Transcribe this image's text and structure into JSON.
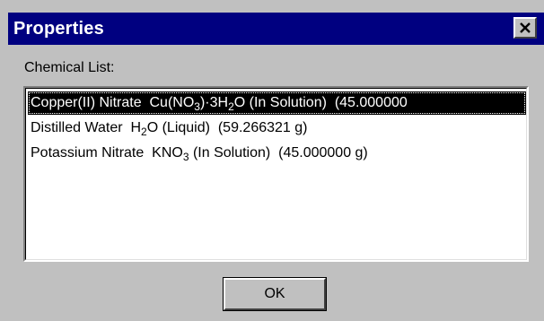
{
  "window": {
    "title": "Properties",
    "close_icon": "close-icon"
  },
  "chemical_list": {
    "label": "Chemical List:",
    "selected_index": 0,
    "items": [
      {
        "name": "Copper(II) Nitrate",
        "formula_parts": [
          "Cu(NO",
          "3",
          ")·3H",
          "2",
          "O"
        ],
        "state": "(In Solution)",
        "amount": "(45.000000"
      },
      {
        "name": "Distilled Water",
        "formula_parts": [
          "H",
          "2",
          "O"
        ],
        "state": "(Liquid)",
        "amount": "(59.266321 g)"
      },
      {
        "name": "Potassium Nitrate",
        "formula_parts": [
          "KNO",
          "3"
        ],
        "state": "(In Solution)",
        "amount": "(45.000000 g)"
      }
    ]
  },
  "buttons": {
    "ok_label": "OK"
  },
  "colors": {
    "titlebar": "#000080",
    "face": "#c0c0c0",
    "selection": "#000000"
  }
}
